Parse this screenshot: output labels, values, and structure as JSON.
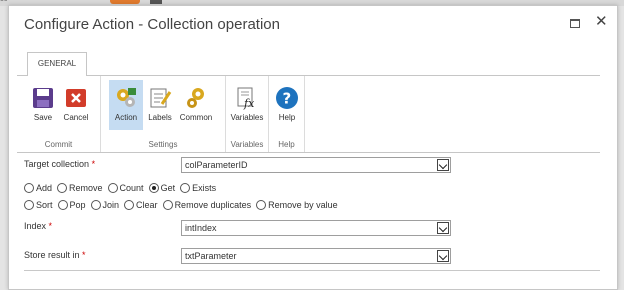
{
  "dialog": {
    "title": "Configure Action - Collection operation"
  },
  "ribbon": {
    "tab": "GENERAL",
    "groups": [
      {
        "label": "Commit",
        "buttons": [
          {
            "label": "Save",
            "icon": "save-icon"
          },
          {
            "label": "Cancel",
            "icon": "cancel-icon"
          }
        ]
      },
      {
        "label": "Settings",
        "buttons": [
          {
            "label": "Action",
            "icon": "action-gears-icon"
          },
          {
            "label": "Labels",
            "icon": "labels-icon"
          },
          {
            "label": "Common",
            "icon": "common-gears-icon"
          }
        ]
      },
      {
        "label": "Variables",
        "buttons": [
          {
            "label": "Variables",
            "icon": "variables-fx-icon"
          }
        ]
      },
      {
        "label": "Help",
        "buttons": [
          {
            "label": "Help",
            "icon": "help-icon"
          }
        ]
      }
    ]
  },
  "form": {
    "target_collection": {
      "label": "Target collection",
      "required": "*",
      "value": "colParameterID"
    },
    "operations_row1": [
      "Add",
      "Remove",
      "Count",
      "Get",
      "Exists"
    ],
    "operations_row2": [
      "Sort",
      "Pop",
      "Join",
      "Clear",
      "Remove duplicates",
      "Remove by value"
    ],
    "selected_operation": "Get",
    "index": {
      "label": "Index",
      "required": "*",
      "value": "intIndex"
    },
    "store_result": {
      "label": "Store result in",
      "required": "*",
      "value": "txtParameter"
    }
  },
  "colors": {
    "accent_selected": "#c5dcf2",
    "required": "#cc0000",
    "help_blue": "#1e73be",
    "cancel_red": "#d23c2a"
  }
}
